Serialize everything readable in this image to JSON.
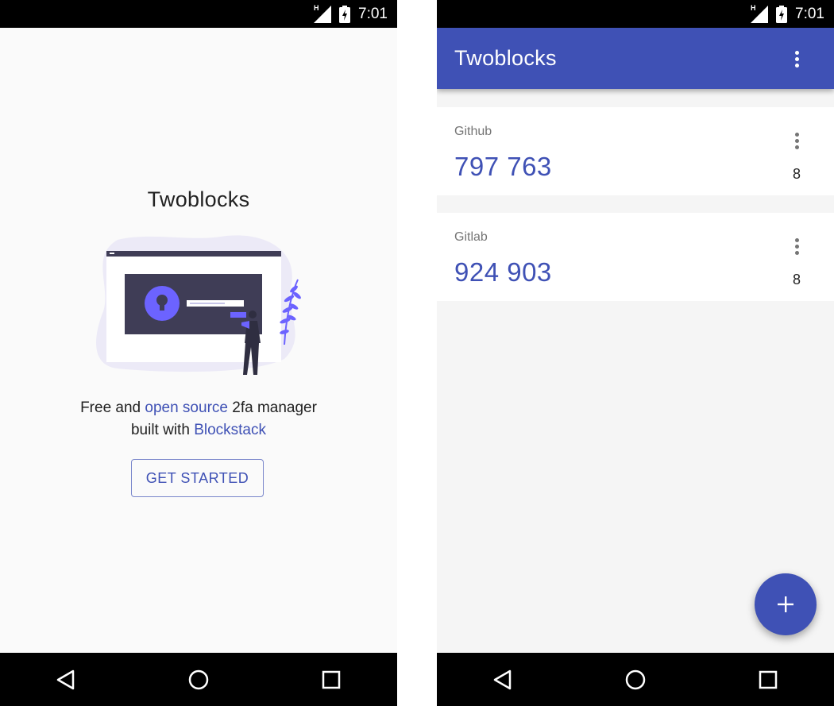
{
  "status_bar": {
    "time": "7:01",
    "network_label": "H"
  },
  "onboarding": {
    "title": "Twoblocks",
    "tagline_prefix": "Free and ",
    "tagline_link1": "open source",
    "tagline_mid": " 2fa manager",
    "tagline_line2_prefix": "built with ",
    "tagline_link2": "Blockstack",
    "button_label": "GET STARTED"
  },
  "main": {
    "app_title": "Twoblocks",
    "accounts": [
      {
        "name": "Github",
        "code": "797 763",
        "countdown": "8"
      },
      {
        "name": "Gitlab",
        "code": "924 903",
        "countdown": "8"
      }
    ]
  },
  "nav": {
    "back_icon": "back-icon",
    "home_icon": "home-icon",
    "recents_icon": "recents-icon"
  },
  "theme": {
    "primary": "#3f51b5",
    "accent_illustration": "#6c63ff",
    "dark_panel": "#3f3d56"
  }
}
